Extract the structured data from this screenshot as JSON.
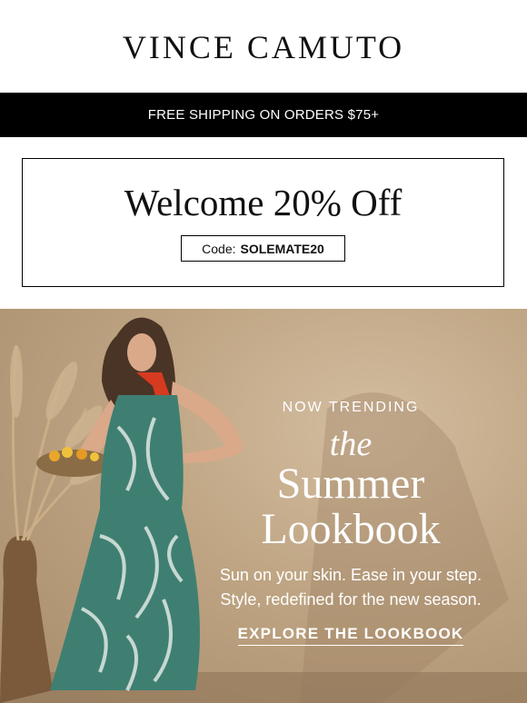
{
  "header": {
    "brand": "VINCE CAMUTO"
  },
  "shipping_bar": {
    "text": "FREE SHIPPING ON ORDERS $75+"
  },
  "promo": {
    "title": "Welcome 20% Off",
    "code_label": "Code:",
    "code_value": "SOLEMATE20"
  },
  "hero": {
    "kicker": "NOW TRENDING",
    "title_line1": "the",
    "title_line2": "Summer",
    "title_line3": "Lookbook",
    "subtext_line1": "Sun on your skin. Ease in your step.",
    "subtext_line2": "Style, redefined for the new season.",
    "cta_label": "EXPLORE THE LOOKBOOK"
  },
  "colors": {
    "bar": "#000000",
    "hero_bg": "#bea482",
    "dress": "#3f7f72",
    "scarf": "#d63a1f"
  }
}
